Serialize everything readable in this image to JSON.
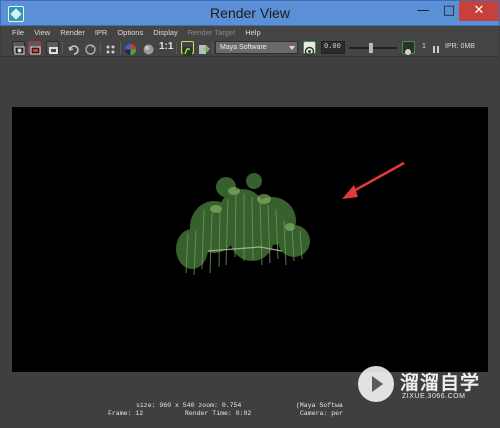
{
  "window": {
    "title": "Render View",
    "minimize_glyph": "—",
    "maximize_glyph": "□",
    "close_glyph": "✕"
  },
  "menu": {
    "items": [
      {
        "label": "File",
        "enabled": true
      },
      {
        "label": "View",
        "enabled": true
      },
      {
        "label": "Render",
        "enabled": true
      },
      {
        "label": "IPR",
        "enabled": true
      },
      {
        "label": "Options",
        "enabled": true
      },
      {
        "label": "Display",
        "enabled": true
      },
      {
        "label": "Render Target",
        "enabled": false
      },
      {
        "label": "Help",
        "enabled": true
      }
    ]
  },
  "toolbar": {
    "ratio_label": "1:1",
    "renderer": "Maya Software",
    "exposure_value": "0.00",
    "layer_count": "1",
    "ipr_status": "IPR: 0MB"
  },
  "status": {
    "size_line": "size: 960 x 540  zoom: 0.754",
    "frame_label": "Frame: 12",
    "render_time_label": "Render Time: 0:02",
    "renderer_line": "(Maya Softwa",
    "camera_line": "Camera: per"
  },
  "watermark": {
    "title": "溜溜自学",
    "url": "ZIXUE.3066.COM"
  },
  "colors": {
    "titlebar": "#5b8fd6",
    "panel": "#444444",
    "canvas": "#000000",
    "arrow": "#e33b3b",
    "foliage": "#4d7a3c"
  },
  "icons": [
    "app-icon",
    "render-icon",
    "ipr-icon",
    "snapshot-icon",
    "refresh-icon",
    "color-wheel-icon",
    "sphere-icon",
    "keep-image-icon",
    "remove-image-icon",
    "exposure-icon",
    "gamma-icon",
    "pause-icon"
  ]
}
